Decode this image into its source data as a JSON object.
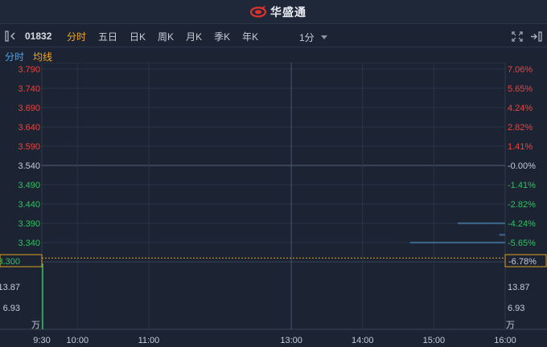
{
  "app": {
    "name": "华盛通"
  },
  "toolbar": {
    "stock_code": "01832",
    "tabs": [
      {
        "label": "分时",
        "active": true
      },
      {
        "label": "五日",
        "active": false
      },
      {
        "label": "日K",
        "active": false
      },
      {
        "label": "周K",
        "active": false
      },
      {
        "label": "月K",
        "active": false
      },
      {
        "label": "季K",
        "active": false
      },
      {
        "label": "年K",
        "active": false
      }
    ],
    "interval": "1分"
  },
  "legend": {
    "price_label": "分时",
    "avg_label": "均线"
  },
  "colors": {
    "up": "#f0413c",
    "down": "#2ec25e",
    "flat": "#c6ccd6",
    "price_line": "#4aa3e8",
    "avg_line": "#f4a623",
    "volume": "#2ec25e"
  },
  "chart_data": {
    "type": "line",
    "prev_close": 3.54,
    "ylim": [
      3.29,
      3.79
    ],
    "price_ticks": [
      "3.790",
      "3.740",
      "3.690",
      "3.640",
      "3.590",
      "3.540",
      "3.490",
      "3.440",
      "3.390",
      "3.340"
    ],
    "pct_ticks": [
      "7.06%",
      "5.65%",
      "4.24%",
      "2.82%",
      "1.41%",
      "-0.00%",
      "-1.41%",
      "-2.82%",
      "-4.24%",
      "-5.65%"
    ],
    "current_price": "3.300",
    "current_pct": "-6.78%",
    "x_ticks": [
      "9:30",
      "10:00",
      "11:00",
      "13:00",
      "14:00",
      "15:00",
      "16:00"
    ],
    "volume_ticks": [
      "13.87",
      "6.93"
    ],
    "volume_unit": "万",
    "series": [
      {
        "segments": [
          {
            "from": "15:20",
            "to": "16:00",
            "value": 3.39
          },
          {
            "from": "14:40",
            "to": "16:00",
            "value": 3.34
          },
          {
            "from": "15:55",
            "to": "16:00",
            "value": 3.36
          }
        ]
      }
    ]
  }
}
